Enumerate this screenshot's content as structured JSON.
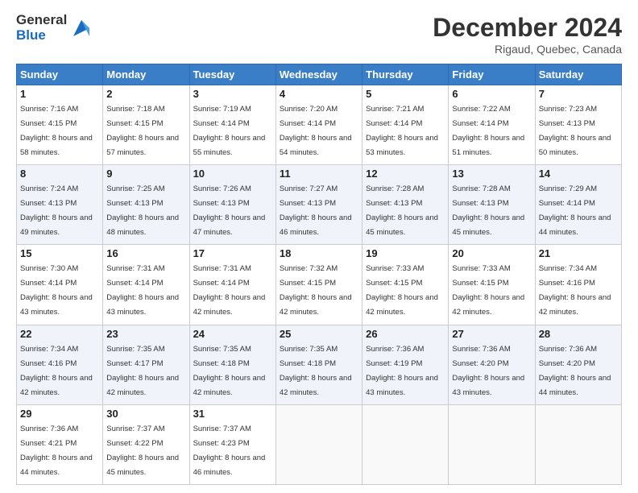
{
  "logo": {
    "general": "General",
    "blue": "Blue"
  },
  "title": {
    "month": "December 2024",
    "location": "Rigaud, Quebec, Canada"
  },
  "headers": [
    "Sunday",
    "Monday",
    "Tuesday",
    "Wednesday",
    "Thursday",
    "Friday",
    "Saturday"
  ],
  "weeks": [
    [
      {
        "day": "1",
        "sunrise": "Sunrise: 7:16 AM",
        "sunset": "Sunset: 4:15 PM",
        "daylight": "Daylight: 8 hours and 58 minutes."
      },
      {
        "day": "2",
        "sunrise": "Sunrise: 7:18 AM",
        "sunset": "Sunset: 4:15 PM",
        "daylight": "Daylight: 8 hours and 57 minutes."
      },
      {
        "day": "3",
        "sunrise": "Sunrise: 7:19 AM",
        "sunset": "Sunset: 4:14 PM",
        "daylight": "Daylight: 8 hours and 55 minutes."
      },
      {
        "day": "4",
        "sunrise": "Sunrise: 7:20 AM",
        "sunset": "Sunset: 4:14 PM",
        "daylight": "Daylight: 8 hours and 54 minutes."
      },
      {
        "day": "5",
        "sunrise": "Sunrise: 7:21 AM",
        "sunset": "Sunset: 4:14 PM",
        "daylight": "Daylight: 8 hours and 53 minutes."
      },
      {
        "day": "6",
        "sunrise": "Sunrise: 7:22 AM",
        "sunset": "Sunset: 4:14 PM",
        "daylight": "Daylight: 8 hours and 51 minutes."
      },
      {
        "day": "7",
        "sunrise": "Sunrise: 7:23 AM",
        "sunset": "Sunset: 4:13 PM",
        "daylight": "Daylight: 8 hours and 50 minutes."
      }
    ],
    [
      {
        "day": "8",
        "sunrise": "Sunrise: 7:24 AM",
        "sunset": "Sunset: 4:13 PM",
        "daylight": "Daylight: 8 hours and 49 minutes."
      },
      {
        "day": "9",
        "sunrise": "Sunrise: 7:25 AM",
        "sunset": "Sunset: 4:13 PM",
        "daylight": "Daylight: 8 hours and 48 minutes."
      },
      {
        "day": "10",
        "sunrise": "Sunrise: 7:26 AM",
        "sunset": "Sunset: 4:13 PM",
        "daylight": "Daylight: 8 hours and 47 minutes."
      },
      {
        "day": "11",
        "sunrise": "Sunrise: 7:27 AM",
        "sunset": "Sunset: 4:13 PM",
        "daylight": "Daylight: 8 hours and 46 minutes."
      },
      {
        "day": "12",
        "sunrise": "Sunrise: 7:28 AM",
        "sunset": "Sunset: 4:13 PM",
        "daylight": "Daylight: 8 hours and 45 minutes."
      },
      {
        "day": "13",
        "sunrise": "Sunrise: 7:28 AM",
        "sunset": "Sunset: 4:13 PM",
        "daylight": "Daylight: 8 hours and 45 minutes."
      },
      {
        "day": "14",
        "sunrise": "Sunrise: 7:29 AM",
        "sunset": "Sunset: 4:14 PM",
        "daylight": "Daylight: 8 hours and 44 minutes."
      }
    ],
    [
      {
        "day": "15",
        "sunrise": "Sunrise: 7:30 AM",
        "sunset": "Sunset: 4:14 PM",
        "daylight": "Daylight: 8 hours and 43 minutes."
      },
      {
        "day": "16",
        "sunrise": "Sunrise: 7:31 AM",
        "sunset": "Sunset: 4:14 PM",
        "daylight": "Daylight: 8 hours and 43 minutes."
      },
      {
        "day": "17",
        "sunrise": "Sunrise: 7:31 AM",
        "sunset": "Sunset: 4:14 PM",
        "daylight": "Daylight: 8 hours and 42 minutes."
      },
      {
        "day": "18",
        "sunrise": "Sunrise: 7:32 AM",
        "sunset": "Sunset: 4:15 PM",
        "daylight": "Daylight: 8 hours and 42 minutes."
      },
      {
        "day": "19",
        "sunrise": "Sunrise: 7:33 AM",
        "sunset": "Sunset: 4:15 PM",
        "daylight": "Daylight: 8 hours and 42 minutes."
      },
      {
        "day": "20",
        "sunrise": "Sunrise: 7:33 AM",
        "sunset": "Sunset: 4:15 PM",
        "daylight": "Daylight: 8 hours and 42 minutes."
      },
      {
        "day": "21",
        "sunrise": "Sunrise: 7:34 AM",
        "sunset": "Sunset: 4:16 PM",
        "daylight": "Daylight: 8 hours and 42 minutes."
      }
    ],
    [
      {
        "day": "22",
        "sunrise": "Sunrise: 7:34 AM",
        "sunset": "Sunset: 4:16 PM",
        "daylight": "Daylight: 8 hours and 42 minutes."
      },
      {
        "day": "23",
        "sunrise": "Sunrise: 7:35 AM",
        "sunset": "Sunset: 4:17 PM",
        "daylight": "Daylight: 8 hours and 42 minutes."
      },
      {
        "day": "24",
        "sunrise": "Sunrise: 7:35 AM",
        "sunset": "Sunset: 4:18 PM",
        "daylight": "Daylight: 8 hours and 42 minutes."
      },
      {
        "day": "25",
        "sunrise": "Sunrise: 7:35 AM",
        "sunset": "Sunset: 4:18 PM",
        "daylight": "Daylight: 8 hours and 42 minutes."
      },
      {
        "day": "26",
        "sunrise": "Sunrise: 7:36 AM",
        "sunset": "Sunset: 4:19 PM",
        "daylight": "Daylight: 8 hours and 43 minutes."
      },
      {
        "day": "27",
        "sunrise": "Sunrise: 7:36 AM",
        "sunset": "Sunset: 4:20 PM",
        "daylight": "Daylight: 8 hours and 43 minutes."
      },
      {
        "day": "28",
        "sunrise": "Sunrise: 7:36 AM",
        "sunset": "Sunset: 4:20 PM",
        "daylight": "Daylight: 8 hours and 44 minutes."
      }
    ],
    [
      {
        "day": "29",
        "sunrise": "Sunrise: 7:36 AM",
        "sunset": "Sunset: 4:21 PM",
        "daylight": "Daylight: 8 hours and 44 minutes."
      },
      {
        "day": "30",
        "sunrise": "Sunrise: 7:37 AM",
        "sunset": "Sunset: 4:22 PM",
        "daylight": "Daylight: 8 hours and 45 minutes."
      },
      {
        "day": "31",
        "sunrise": "Sunrise: 7:37 AM",
        "sunset": "Sunset: 4:23 PM",
        "daylight": "Daylight: 8 hours and 46 minutes."
      },
      null,
      null,
      null,
      null
    ]
  ]
}
